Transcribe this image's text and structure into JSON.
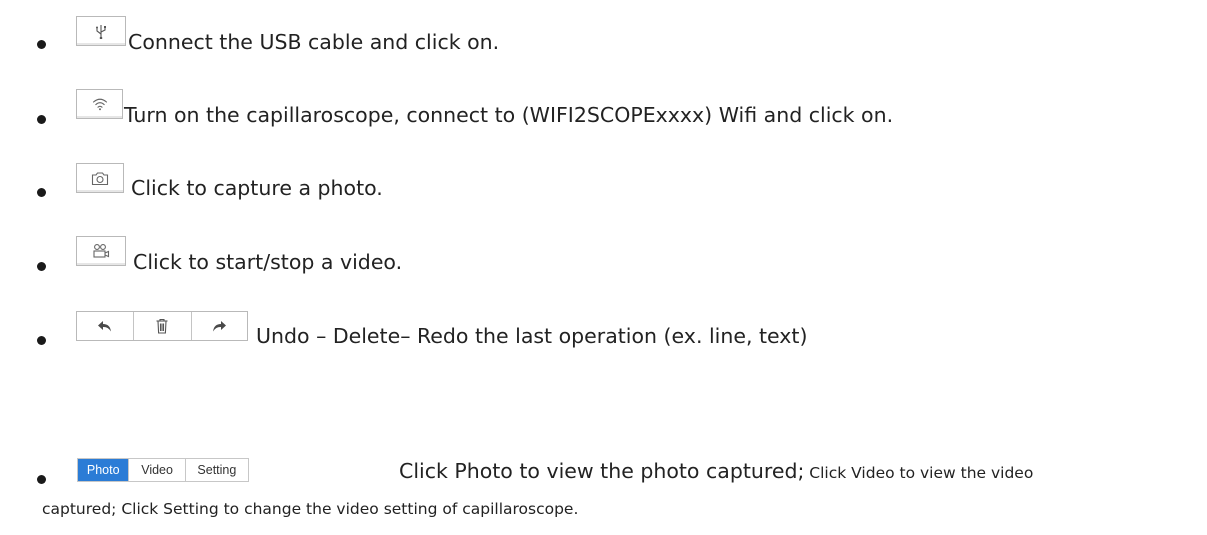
{
  "items": [
    {
      "icon": "usb-icon",
      "text": "Connect the USB cable and click on."
    },
    {
      "icon": "wifi-icon",
      "text": "Turn on the capillaroscope, connect to (WIFI2SCOPExxxx)  Wifi and click on."
    },
    {
      "icon": "camera-icon",
      "text": "Click to capture a photo."
    },
    {
      "icon": "video-camera-icon",
      "text": "Click to start/stop a video."
    },
    {
      "icons": [
        "undo-icon",
        "trash-icon",
        "redo-icon"
      ],
      "text": "Undo – Delete– Redo the last operation (ex. line, text)"
    },
    {
      "tabs": [
        {
          "label": "Photo",
          "active": true
        },
        {
          "label": "Video",
          "active": false
        },
        {
          "label": "Setting",
          "active": false
        }
      ],
      "text_large": "Click Photo to view the photo captured;",
      "text_small_1": " Click  Video to view the video",
      "text_small_2": "captured; Click Setting to change the video setting of capillaroscope."
    }
  ],
  "colors": {
    "active_tab": "#2b7cd6",
    "button_border": "#b9b9b9"
  }
}
